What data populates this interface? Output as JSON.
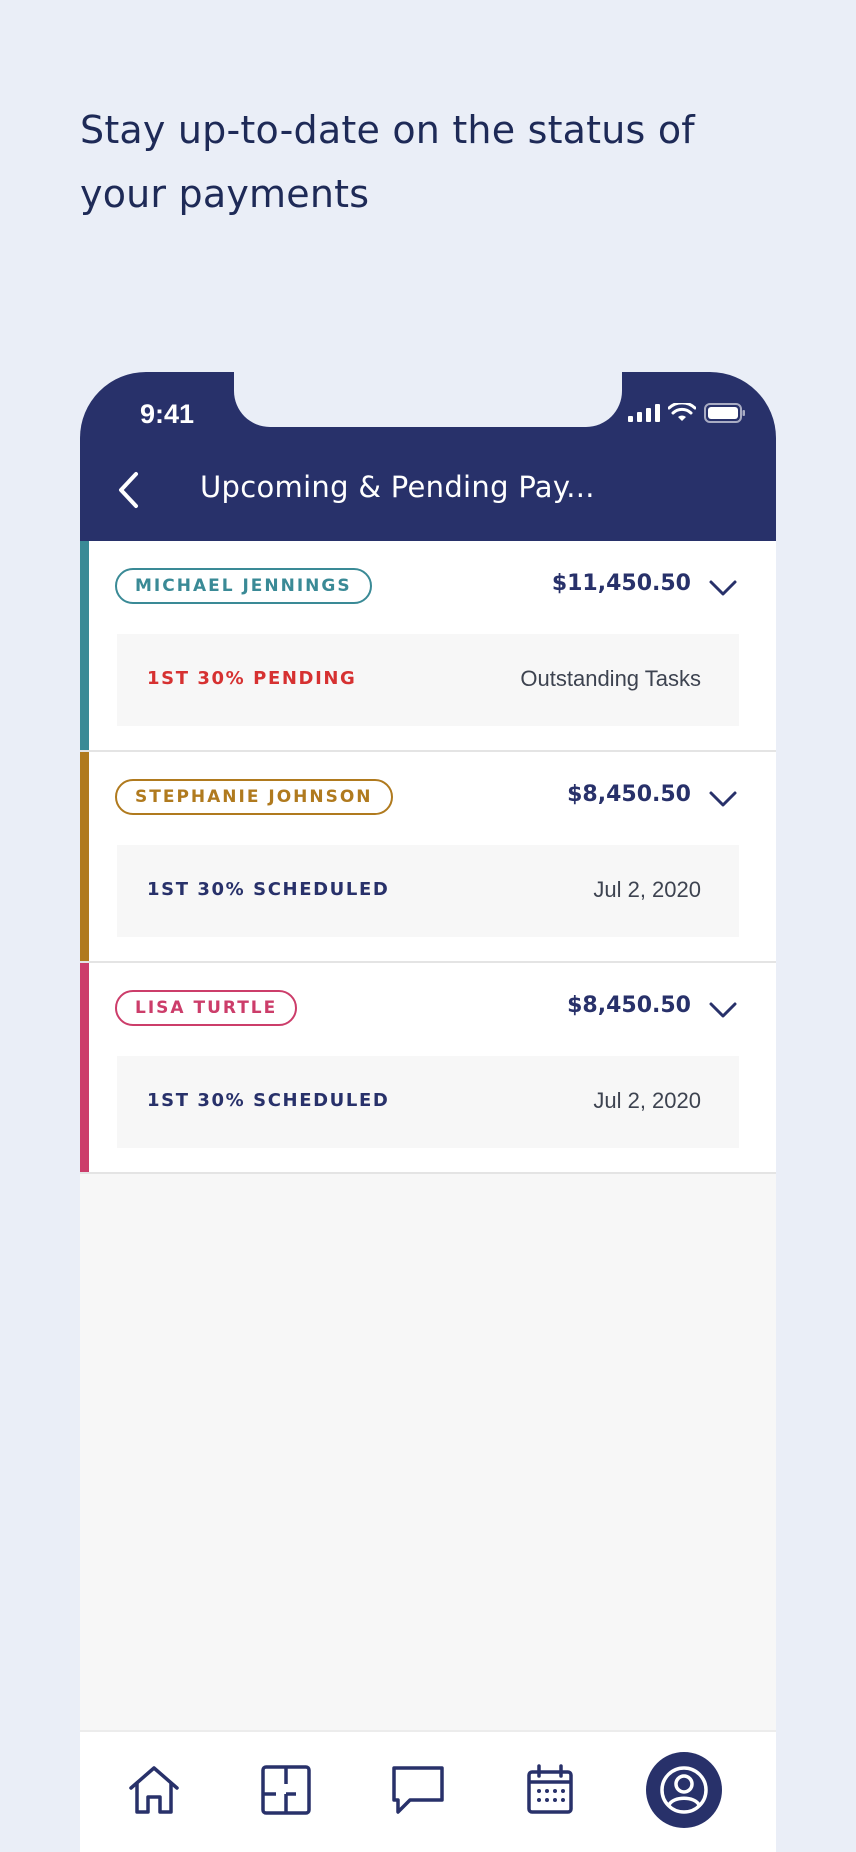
{
  "headline": "Stay up-to-date on the status of your payments",
  "status_bar": {
    "time": "9:41"
  },
  "nav": {
    "title": "Upcoming & Pending Pay...",
    "back_icon": "chevron-left-icon"
  },
  "colors": {
    "navy": "#28316a",
    "teal": "#3a8a96",
    "amber": "#b07a1e",
    "crimson": "#cc3d6a",
    "red": "#d63131"
  },
  "payments": [
    {
      "name": "MICHAEL JENNINGS",
      "amount": "$11,450.50",
      "status": "1ST 30% PENDING",
      "detail": "Outstanding Tasks",
      "accent": "#3a8a96",
      "status_color": "#d63131"
    },
    {
      "name": "STEPHANIE JOHNSON",
      "amount": "$8,450.50",
      "status": "1ST 30% SCHEDULED",
      "detail": "Jul 2, 2020",
      "accent": "#b07a1e",
      "status_color": "#28316a"
    },
    {
      "name": "LISA TURTLE",
      "amount": "$8,450.50",
      "status": "1ST 30% SCHEDULED",
      "detail": "Jul 2, 2020",
      "accent": "#cc3d6a",
      "status_color": "#28316a"
    }
  ],
  "tabbar": {
    "items": [
      "home-icon",
      "floorplan-icon",
      "chat-icon",
      "calendar-icon",
      "profile-icon"
    ]
  }
}
